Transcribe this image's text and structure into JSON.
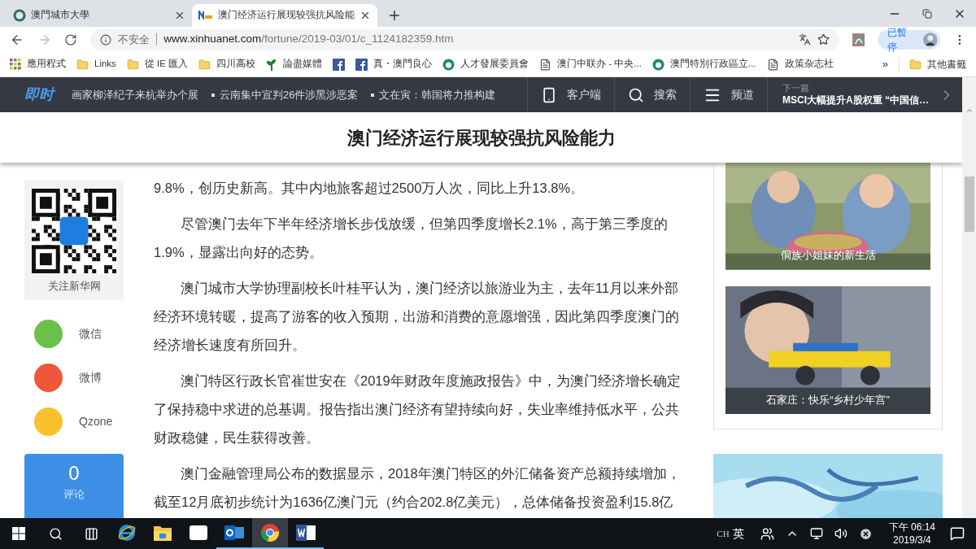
{
  "tabs": [
    {
      "title": "澳門城市大學",
      "selected": false
    },
    {
      "title": "澳门经济运行展现较强抗风险能",
      "selected": true
    }
  ],
  "address": {
    "security": "不安全",
    "domain": "www.xinhuanet.com",
    "path": "/fortune/2019-03/01/c_1124182359.htm"
  },
  "profile": {
    "label": "已暫停"
  },
  "bookmarks": [
    {
      "kind": "apps",
      "label": "應用程式"
    },
    {
      "kind": "folder",
      "label": "Links"
    },
    {
      "kind": "folder",
      "label": "從 IE 匯入"
    },
    {
      "kind": "folder",
      "label": "四川高校"
    },
    {
      "kind": "plant",
      "label": "論盡媒體"
    },
    {
      "kind": "facebook"
    },
    {
      "kind": "facebook",
      "label": "真・澳門良心"
    },
    {
      "kind": "emblem",
      "label": "人才發展委員會"
    },
    {
      "kind": "page",
      "label": "澳门中联办 - 中央..."
    },
    {
      "kind": "emblem",
      "label": "澳門特別行政區立..."
    },
    {
      "kind": "page",
      "label": "政策杂志社"
    }
  ],
  "bookmarks_more": "»",
  "bookmarks_other": "其他書籤",
  "site_nav": {
    "logo": "即时",
    "ticker": [
      "画家柳泽纪子来杭举办个展",
      "云南集中宣判26件涉黑涉恶案",
      "文在寅：韩国将力推构建"
    ],
    "links": [
      {
        "kind": "phone",
        "label": "客户端"
      },
      {
        "kind": "search",
        "label": "搜索"
      },
      {
        "kind": "menu",
        "label": "频道"
      }
    ],
    "next": {
      "caption": "下一篇",
      "title": "MSCI大幅提升A股权重 “中国信…"
    }
  },
  "headline": "澳门经济运行展现较强抗风险能力",
  "sidebar": {
    "follow": "关注新华网",
    "share": [
      {
        "label": "微信",
        "color": "#6cc04a"
      },
      {
        "label": "微博",
        "color": "#f0563a"
      },
      {
        "label": "Qzone",
        "color": "#fbc02d"
      }
    ],
    "comments": {
      "count": "0",
      "label": "评论"
    }
  },
  "article": {
    "paragraphs": [
      {
        "text": "9.8%，创历史新高。其中内地旅客超过2500万人次，同比上升13.8%。",
        "continued": true
      },
      {
        "text": "尽管澳门去年下半年经济增长步伐放缓，但第四季度增长2.1%，高于第三季度的1.9%，显露出向好的态势。",
        "continued": false
      },
      {
        "text": "澳门城市大学协理副校长叶桂平认为，澳门经济以旅游业为主，去年11月以来外部经济环境转暖，提高了游客的收入预期，出游和消费的意愿增强，因此第四季度澳门的经济增长速度有所回升。",
        "continued": false
      },
      {
        "text": "澳门特区行政长官崔世安在《2019年财政年度施政报告》中，为澳门经济增长确定了保持稳中求进的总基调。报告指出澳门经济有望持续向好，失业率维持低水平，公共财政稳健，民生获得改善。",
        "continued": false
      },
      {
        "text": "澳门金融管理局公布的数据显示，2018年澳门特区的外汇储备资产总额持续增加，截至12月底初步统计为1636亿澳门元（约合202.8亿美元），总体储备投资盈利15.8亿",
        "continued": false
      }
    ]
  },
  "photos": [
    {
      "caption": "侗族小姐妹的新生活"
    },
    {
      "caption": "石家庄：快乐“乡村少年宫”"
    }
  ],
  "taskbar": {
    "apps": [
      {
        "kind": "ie",
        "running": false,
        "selected": false
      },
      {
        "kind": "explorer",
        "running": false,
        "selected": false
      },
      {
        "kind": "mail",
        "running": false,
        "selected": false
      },
      {
        "kind": "outlook",
        "running": true,
        "selected": false
      },
      {
        "kind": "chrome",
        "running": true,
        "selected": true
      },
      {
        "kind": "word",
        "running": true,
        "selected": false
      }
    ],
    "ime": {
      "lang": "CH",
      "mode": "英"
    },
    "time": "下午 06:14",
    "date": "2019/3/4"
  }
}
